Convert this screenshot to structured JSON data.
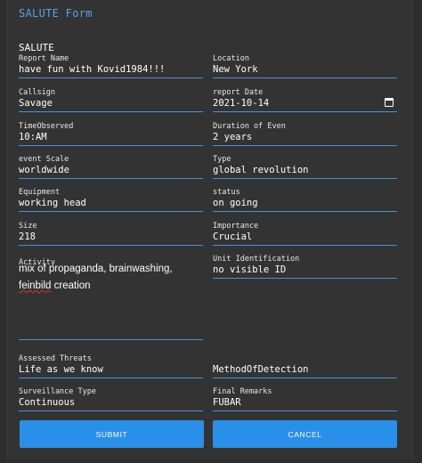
{
  "form": {
    "title": "SALUTE Form",
    "name": "SALUTE"
  },
  "fields": {
    "report_name": {
      "label": "Report Name",
      "value": "have fun with Kovid1984!!!"
    },
    "location": {
      "label": "Location",
      "value": "New York"
    },
    "callsign": {
      "label": "Callsign",
      "value": "Savage"
    },
    "report_date": {
      "label": "report Date",
      "value": "2021-10-14"
    },
    "time_observed": {
      "label": "TimeObserved",
      "value": "10:AM"
    },
    "duration": {
      "label": "Duration of Even",
      "value": "2 years"
    },
    "event_scale": {
      "label": "event Scale",
      "value": "worldwide"
    },
    "type": {
      "label": "Type",
      "value": "global revolution"
    },
    "equipment": {
      "label": "Equipment",
      "value": "working head"
    },
    "status": {
      "label": "status",
      "value": "on going"
    },
    "size": {
      "label": "Size",
      "value": "218"
    },
    "importance": {
      "label": "Importance",
      "value": "Crucial"
    },
    "activity": {
      "label": "Activity",
      "value_part1": "mix of propaganda, brainwashing, ",
      "value_misspelled": "feinbild",
      "value_part2": " creation"
    },
    "unit_id": {
      "label": "Unit Identification",
      "value": "no visible ID"
    },
    "assessed_threats": {
      "label": "Assessed Threats",
      "value": "Life as we know"
    },
    "method_of_detection": {
      "label": "MethodOfDetection",
      "value": ""
    },
    "surveillance_type": {
      "label": "Surveillance Type",
      "value": "Continuous"
    },
    "final_remarks": {
      "label": "Final Remarks",
      "value": "FUBAR"
    }
  },
  "buttons": {
    "submit": "SUBMIT",
    "cancel": "CANCEL"
  },
  "icons": {
    "calendar": "calendar-icon"
  },
  "colors": {
    "accent": "#2a8fe8",
    "title": "#5aa0e8",
    "underline": "#4d8fd6",
    "background": "#333333"
  }
}
